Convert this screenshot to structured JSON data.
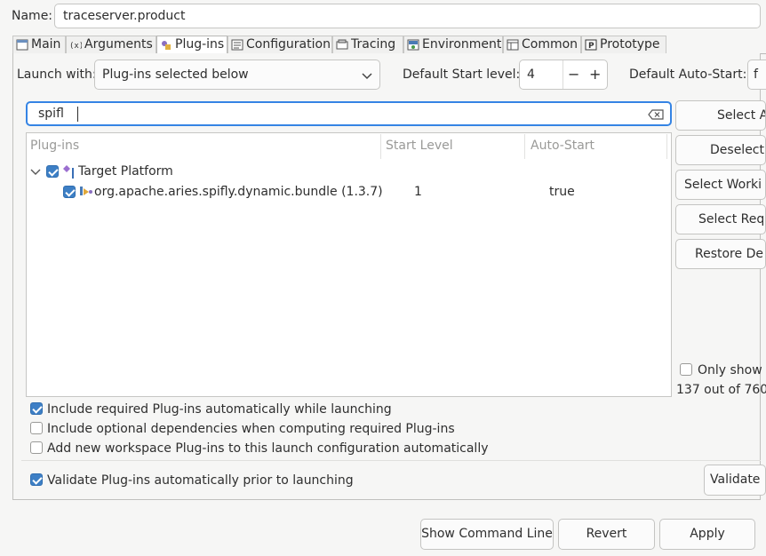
{
  "name": {
    "label": "Name:",
    "value": "traceserver.product"
  },
  "tabs": [
    {
      "label": "Main",
      "icon": "main-icon"
    },
    {
      "label": "Arguments",
      "icon": "arguments-icon"
    },
    {
      "label": "Plug-ins",
      "icon": "plugins-icon"
    },
    {
      "label": "Configuration",
      "icon": "configuration-icon"
    },
    {
      "label": "Tracing",
      "icon": "tracing-icon"
    },
    {
      "label": "Environment",
      "icon": "environment-icon"
    },
    {
      "label": "Common",
      "icon": "common-icon"
    },
    {
      "label": "Prototype",
      "icon": "prototype-icon"
    }
  ],
  "launch": {
    "label": "Launch with:",
    "value": "Plug-ins selected below",
    "start_level_label": "Default Start level:",
    "start_level_value": "4",
    "minus": "−",
    "plus": "+",
    "auto_start_label": "Default Auto-Start:",
    "auto_start_value": "f"
  },
  "filter": {
    "value": "spifl"
  },
  "table": {
    "headers": [
      "Plug-ins",
      "Start Level",
      "Auto-Start"
    ],
    "group": {
      "label": "Target Platform",
      "checked": true
    },
    "rows": [
      {
        "name": "org.apache.aries.spifly.dynamic.bundle (1.3.7)",
        "start_level": "1",
        "auto_start": "true",
        "checked": true
      }
    ]
  },
  "side_buttons": [
    "Select A",
    "Deselect",
    "Select Worki",
    "Select Req",
    "Restore De"
  ],
  "only_show": {
    "label": "Only show",
    "count": "137 out of 760"
  },
  "options": [
    {
      "label": "Include required Plug-ins automatically while launching",
      "checked": true
    },
    {
      "label": "Include optional dependencies when computing required Plug-ins",
      "checked": false
    },
    {
      "label": "Add new workspace Plug-ins to this launch configuration automatically",
      "checked": false
    }
  ],
  "validate": {
    "label": "Validate Plug-ins automatically prior to launching",
    "checked": true,
    "button": "Validate"
  },
  "footer": {
    "show_cmd": "Show Command Line",
    "revert": "Revert",
    "apply": "Apply"
  },
  "colors": {
    "accent": "#3d7fc5",
    "focus": "#3584e4"
  }
}
